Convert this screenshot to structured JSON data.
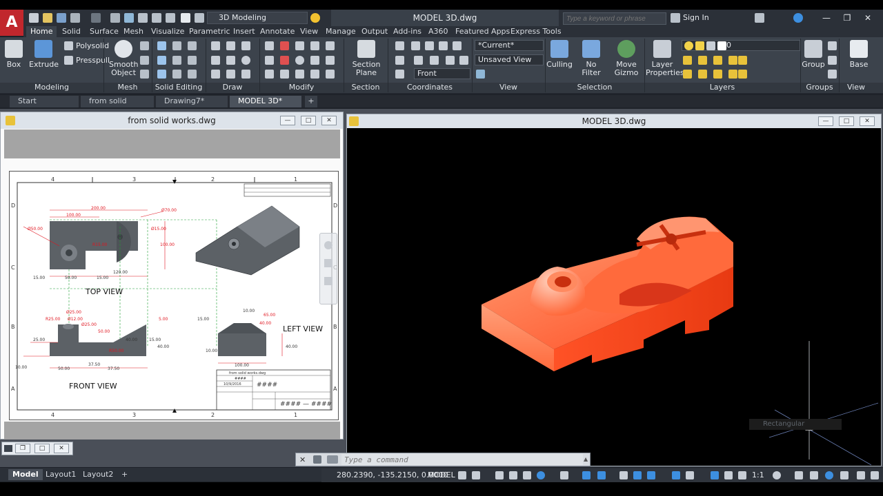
{
  "app": {
    "logo": "A",
    "window_title": "MODEL 3D.dwg",
    "workspace": "3D Modeling",
    "search_placeholder": "Type a keyword or phrase",
    "sign_in": "Sign In"
  },
  "ribbon_tabs": [
    "Home",
    "Solid",
    "Surface",
    "Mesh",
    "Visualize",
    "Parametric",
    "Insert",
    "Annotate",
    "View",
    "Manage",
    "Output",
    "Add-ins",
    "A360",
    "Featured Apps",
    "Express Tools"
  ],
  "ribbon": {
    "box": "Box",
    "extrude": "Extrude",
    "polysolid": "Polysolid",
    "presspull": "Presspull",
    "smooth_object": [
      "Smooth",
      "Object"
    ],
    "section_plane": [
      "Section",
      "Plane"
    ],
    "current_visual": "*Current*",
    "unsaved_view": "Unsaved View",
    "front": "Front",
    "culling": "Culling",
    "no_filter": "No Filter",
    "move_gizmo": [
      "Move",
      "Gizmo"
    ],
    "layer_properties": [
      "Layer",
      "Properties"
    ],
    "layer_value": "0",
    "group": "Group",
    "base": "Base"
  },
  "panels": [
    "Modeling",
    "Mesh",
    "Solid Editing",
    "Draw",
    "Modify",
    "Section",
    "Coordinates",
    "View",
    "Selection",
    "Layers",
    "Groups",
    "View"
  ],
  "doc_tabs": [
    "Start",
    "from solid works*",
    "Drawing7*",
    "MODEL 3D*"
  ],
  "left_window": {
    "title": "from solid works.dwg",
    "views": {
      "top": "TOP VIEW",
      "front": "FRONT VIEW",
      "left": "LEFT VIEW"
    },
    "border_cols": [
      "4",
      "3",
      "2",
      "1"
    ],
    "border_rows": [
      "D",
      "C",
      "B",
      "A"
    ],
    "dims": [
      "200.00",
      "100.00",
      "Ø70.00",
      "Ø50.00",
      "Ø15.00",
      "R15.00",
      "100.00",
      "15.00",
      "50.00",
      "15.00",
      "120.00",
      "R25.00",
      "Ø25.00",
      "Ø12.00",
      "Ø25.00",
      "25.00",
      "50.00",
      "5.00",
      "40.00",
      "R50.00",
      "15.00",
      "40.00",
      "10.00",
      "50.00",
      "37.50",
      "37.50",
      "15.00",
      "10.00",
      "65.00",
      "40.00",
      "40.00",
      "10.00",
      "100.00"
    ],
    "title_block": {
      "file": "from solid works.dwg",
      "marks": "####",
      "date": "10/9/2016",
      "number": "#### — ####"
    }
  },
  "right_window": {
    "title": "MODEL 3D.dwg",
    "tooltip": "Rectangular"
  },
  "command": {
    "placeholder": "Type a command"
  },
  "layout_tabs": [
    "Model",
    "Layout1",
    "Layout2"
  ],
  "status": {
    "coords": "280.2390, -135.2150, 0.0000",
    "space": "MODEL",
    "scale": "1:1"
  },
  "colors": {
    "model_orange": "#ff5a2e",
    "drawing_red": "#e0141e",
    "drawing_green": "#1f9d32",
    "solid_gray": "#5c6166"
  }
}
